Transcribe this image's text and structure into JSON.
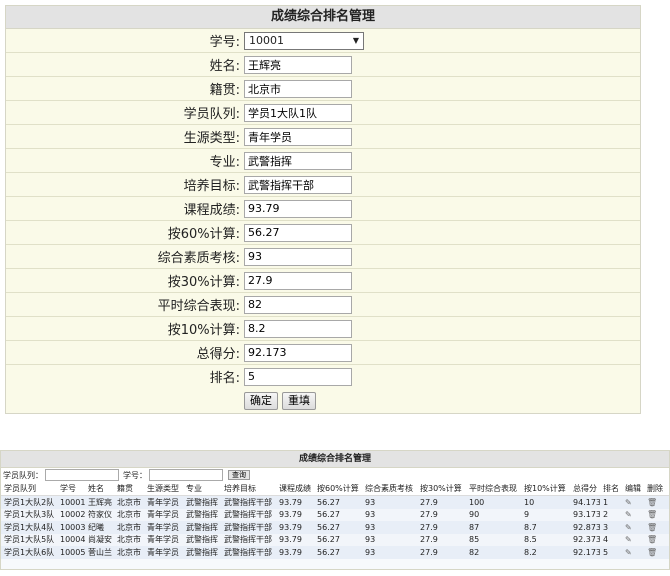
{
  "form": {
    "title": "成绩综合排名管理",
    "fields": [
      {
        "label": "学号:",
        "value": "10001",
        "type": "select"
      },
      {
        "label": "姓名:",
        "value": "王辉亮"
      },
      {
        "label": "籍贯:",
        "value": "北京市"
      },
      {
        "label": "学员队列:",
        "value": "学员1大队1队"
      },
      {
        "label": "生源类型:",
        "value": "青年学员"
      },
      {
        "label": "专业:",
        "value": "武警指挥"
      },
      {
        "label": "培养目标:",
        "value": "武警指挥干部"
      },
      {
        "label": "课程成绩:",
        "value": "93.79"
      },
      {
        "label": "按60%计算:",
        "value": "56.27"
      },
      {
        "label": "综合素质考核:",
        "value": "93"
      },
      {
        "label": "按30%计算:",
        "value": "27.9"
      },
      {
        "label": "平时综合表现:",
        "value": "82"
      },
      {
        "label": "按10%计算:",
        "value": "8.2"
      },
      {
        "label": "总得分:",
        "value": "92.173"
      },
      {
        "label": "排名:",
        "value": "5"
      }
    ],
    "confirm_label": "确定",
    "reset_label": "重填"
  },
  "list": {
    "title": "成绩综合排名管理",
    "filter_queue_label": "学员队列：",
    "filter_id_label": "学号：",
    "search_label": "查询",
    "columns": [
      "学员队列",
      "学号",
      "姓名",
      "籍贯",
      "生源类型",
      "专业",
      "培养目标",
      "课程成绩",
      "按60%计算",
      "综合素质考核",
      "按30%计算",
      "平时综合表现",
      "按10%计算",
      "总得分",
      "排名",
      "编辑",
      "删除"
    ],
    "rows": [
      [
        "学员1大队2队",
        "10001",
        "王辉亮",
        "北京市",
        "青年学员",
        "武警指挥",
        "武警指挥干部",
        "93.79",
        "56.27",
        "93",
        "27.9",
        "100",
        "10",
        "94.173",
        "1"
      ],
      [
        "学员1大队3队",
        "10002",
        "符家仪",
        "北京市",
        "青年学员",
        "武警指挥",
        "武警指挥干部",
        "93.79",
        "56.27",
        "93",
        "27.9",
        "90",
        "9",
        "93.173",
        "2"
      ],
      [
        "学员1大队4队",
        "10003",
        "纪曦",
        "北京市",
        "青年学员",
        "武警指挥",
        "武警指挥干部",
        "93.79",
        "56.27",
        "93",
        "27.9",
        "87",
        "8.7",
        "92.873",
        "3"
      ],
      [
        "学员1大队5队",
        "10004",
        "尚凝安",
        "北京市",
        "青年学员",
        "武警指挥",
        "武警指挥干部",
        "93.79",
        "56.27",
        "93",
        "27.9",
        "85",
        "8.5",
        "92.373",
        "4"
      ],
      [
        "学员1大队6队",
        "10005",
        "菅山兰",
        "北京市",
        "青年学员",
        "武警指挥",
        "武警指挥干部",
        "93.79",
        "56.27",
        "93",
        "27.9",
        "82",
        "8.2",
        "92.173",
        "5"
      ]
    ],
    "edit_icon": "✎",
    "delete_icon": "🗑"
  }
}
